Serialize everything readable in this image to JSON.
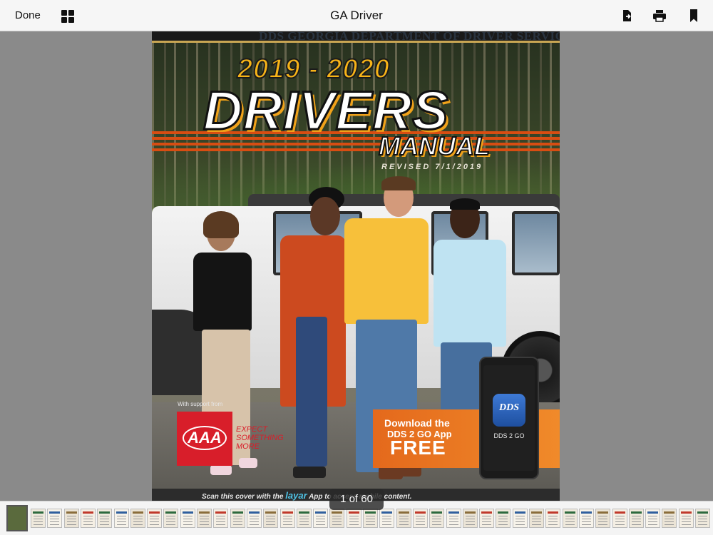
{
  "toolbar": {
    "done_label": "Done",
    "title": "GA Driver"
  },
  "cover": {
    "header": "DDS GEORGIA DEPARTMENT OF DRIVER SERVICES",
    "year": "2019 - 2020",
    "title_main": "DRIVERS",
    "title_sub": "MANUAL",
    "revised": "REVISED 7/1/2019",
    "support_text": "With support from",
    "aaa_letters": "AAA",
    "aaa_tagline": "EXPECT SOMETHING MORE",
    "app_line1": "Download the",
    "app_line2": "DDS 2 GO App",
    "app_line3": "FREE",
    "phone_icon_text": "DDS",
    "phone_label": "DDS 2 GO",
    "scan_before": "Scan this cover with the",
    "scan_brand": "layar",
    "scan_after": "App to access mobile content."
  },
  "page_indicator": "1 of 60",
  "thumbnails": {
    "total": 42,
    "active_index": 0
  },
  "colors": {
    "accent_orange": "#e4691c",
    "title_yellow": "#f7b418",
    "aaa_red": "#d81e2a"
  }
}
